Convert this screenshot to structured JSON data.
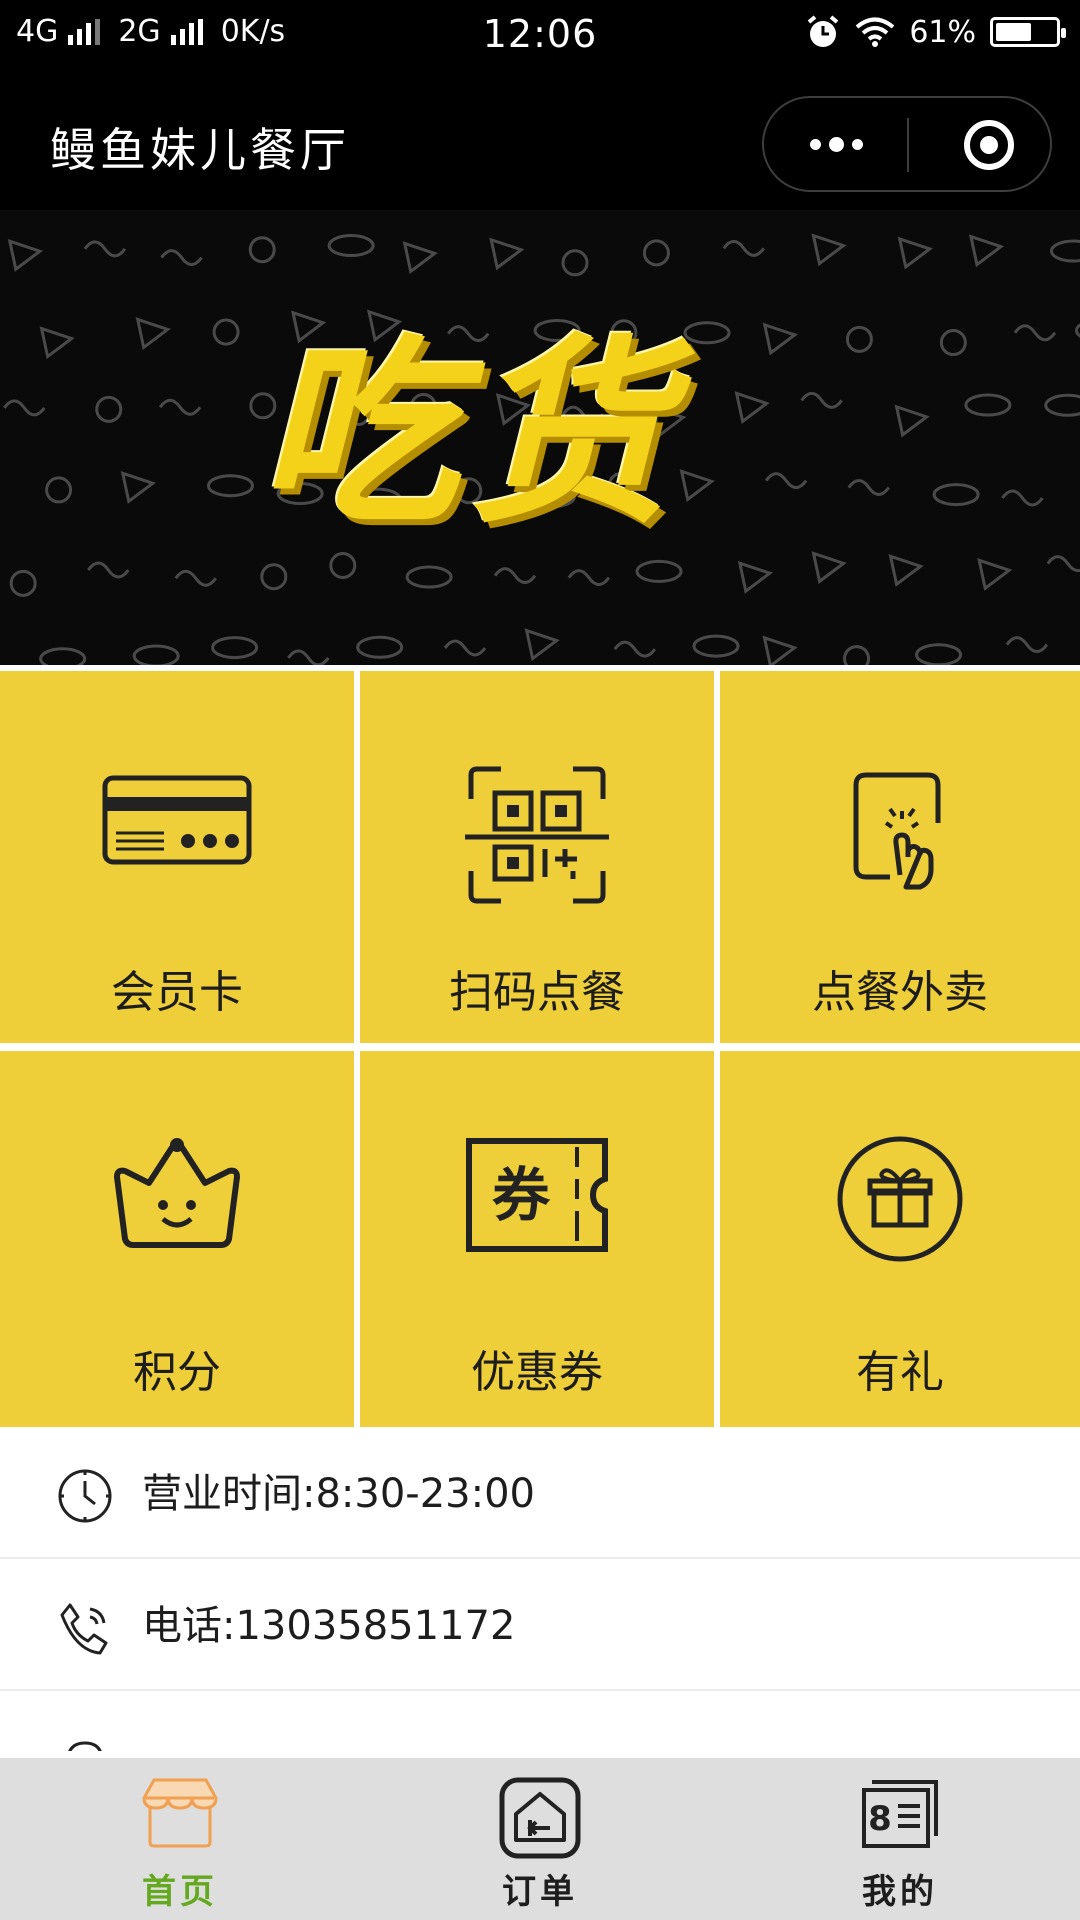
{
  "status_bar": {
    "network1": "4G",
    "network2": "2G",
    "speed": "0K/s",
    "time": "12:06",
    "battery": "61%",
    "battery_level": 0.61
  },
  "nav": {
    "title": "鳗鱼妹儿餐厅"
  },
  "banner": {
    "title": "吃货"
  },
  "grid": {
    "items": [
      {
        "label": "会员卡",
        "icon": "membership-card-icon"
      },
      {
        "label": "扫码点餐",
        "icon": "qr-scan-icon"
      },
      {
        "label": "点餐外卖",
        "icon": "tap-order-icon"
      },
      {
        "label": "积分",
        "icon": "crown-icon"
      },
      {
        "label": "优惠券",
        "icon": "coupon-icon"
      },
      {
        "label": "有礼",
        "icon": "gift-icon"
      }
    ]
  },
  "info": {
    "hours": "营业时间:8:30-23:00",
    "phone": "电话:13035851172"
  },
  "tabs": [
    {
      "label": "首页",
      "icon": "storefront-icon",
      "active": true
    },
    {
      "label": "订单",
      "icon": "order-icon",
      "active": false
    },
    {
      "label": "我的",
      "icon": "profile-card-icon",
      "active": false
    }
  ],
  "colors": {
    "accent_yellow": "#eecf3a",
    "active_tab": "#63a81e",
    "banner_bg": "#0a0a0a"
  }
}
